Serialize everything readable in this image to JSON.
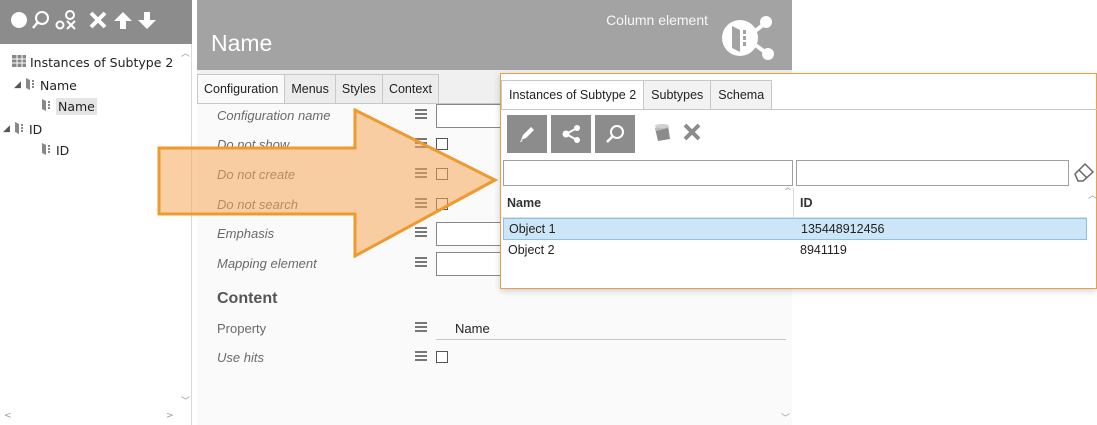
{
  "left_panel": {
    "toolbar_icons": [
      "circle-icon",
      "search-icon",
      "link-delete-icon",
      "close-icon",
      "arrow-up-icon",
      "arrow-down-icon"
    ],
    "tree": {
      "root": "Instances of Subtype 2",
      "nodes": [
        {
          "label": "Name",
          "child": "Name",
          "child_selected": true
        },
        {
          "label": "ID",
          "child": "ID",
          "child_selected": false
        }
      ]
    }
  },
  "config_panel": {
    "title": "Name",
    "subtitle": "Column element",
    "tabs": [
      "Configuration",
      "Menus",
      "Styles",
      "Context"
    ],
    "active_tab": "Configuration",
    "fields": [
      {
        "label": "Configuration name",
        "kind": "input"
      },
      {
        "label": "Do not show",
        "kind": "checkbox"
      },
      {
        "label": "Do not create",
        "kind": "checkbox"
      },
      {
        "label": "Do not search",
        "kind": "checkbox"
      },
      {
        "label": "Emphasis",
        "kind": "input"
      },
      {
        "label": "Mapping element",
        "kind": "input"
      }
    ],
    "content_heading": "Content",
    "content_fields": [
      {
        "label": "Property",
        "value": "Name"
      },
      {
        "label": "Use hits",
        "kind": "checkbox"
      }
    ]
  },
  "popup": {
    "tabs": [
      "Instances of Subtype 2",
      "Subtypes",
      "Schema"
    ],
    "active_tab": "Instances of Subtype 2",
    "toolbar_icons": [
      "pencil-icon",
      "relations-icon",
      "search-icon",
      "bucket-icon",
      "close-icon"
    ],
    "columns": [
      "Name",
      "ID"
    ],
    "rows": [
      {
        "name": "Object 1",
        "id": "135448912456",
        "selected": true
      },
      {
        "name": "Object 2",
        "id": "8941119",
        "selected": false
      }
    ]
  },
  "colors": {
    "toolbar_gray": "#8c8c8c",
    "header_gray": "#a3a3a3",
    "arrow_orange": "#f5a85a",
    "selection_blue": "#cde6f7"
  }
}
